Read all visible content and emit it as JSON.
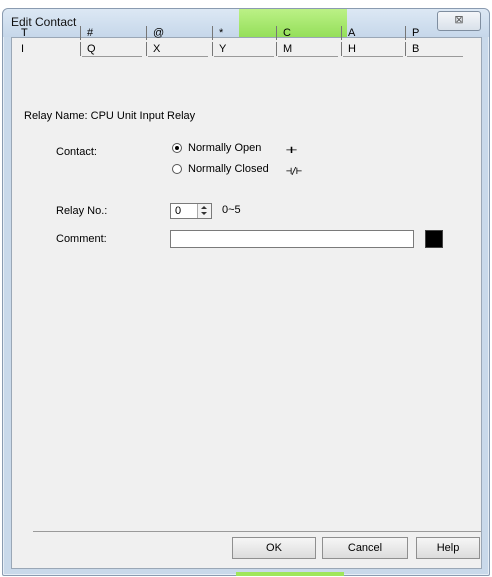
{
  "window": {
    "title": "Edit Contact",
    "close_glyph": "⊠"
  },
  "tabs": {
    "row1": [
      "T",
      "#",
      "@",
      "*",
      "C",
      "A",
      "P"
    ],
    "row2": [
      "I",
      "Q",
      "X",
      "Y",
      "M",
      "H",
      "B"
    ],
    "active": "I"
  },
  "panel": {
    "relay_name_label": "Relay Name: CPU Unit Input Relay",
    "contact_label": "Contact:",
    "contact_options": [
      {
        "label": "Normally Open",
        "symbol": "⊣⊢",
        "selected": true
      },
      {
        "label": "Normally Closed",
        "symbol": "⊣/⊢",
        "selected": false
      }
    ],
    "relay_no_label": "Relay No.:",
    "relay_no_value": "0",
    "relay_no_range": "0~5",
    "comment_label": "Comment:",
    "comment_value": "",
    "comment_color": "#000000"
  },
  "buttons": {
    "ok": "OK",
    "cancel": "Cancel",
    "help": "Help"
  },
  "colors": {
    "title_highlight": "#9fe65a",
    "frame": "#c9d9ea"
  }
}
